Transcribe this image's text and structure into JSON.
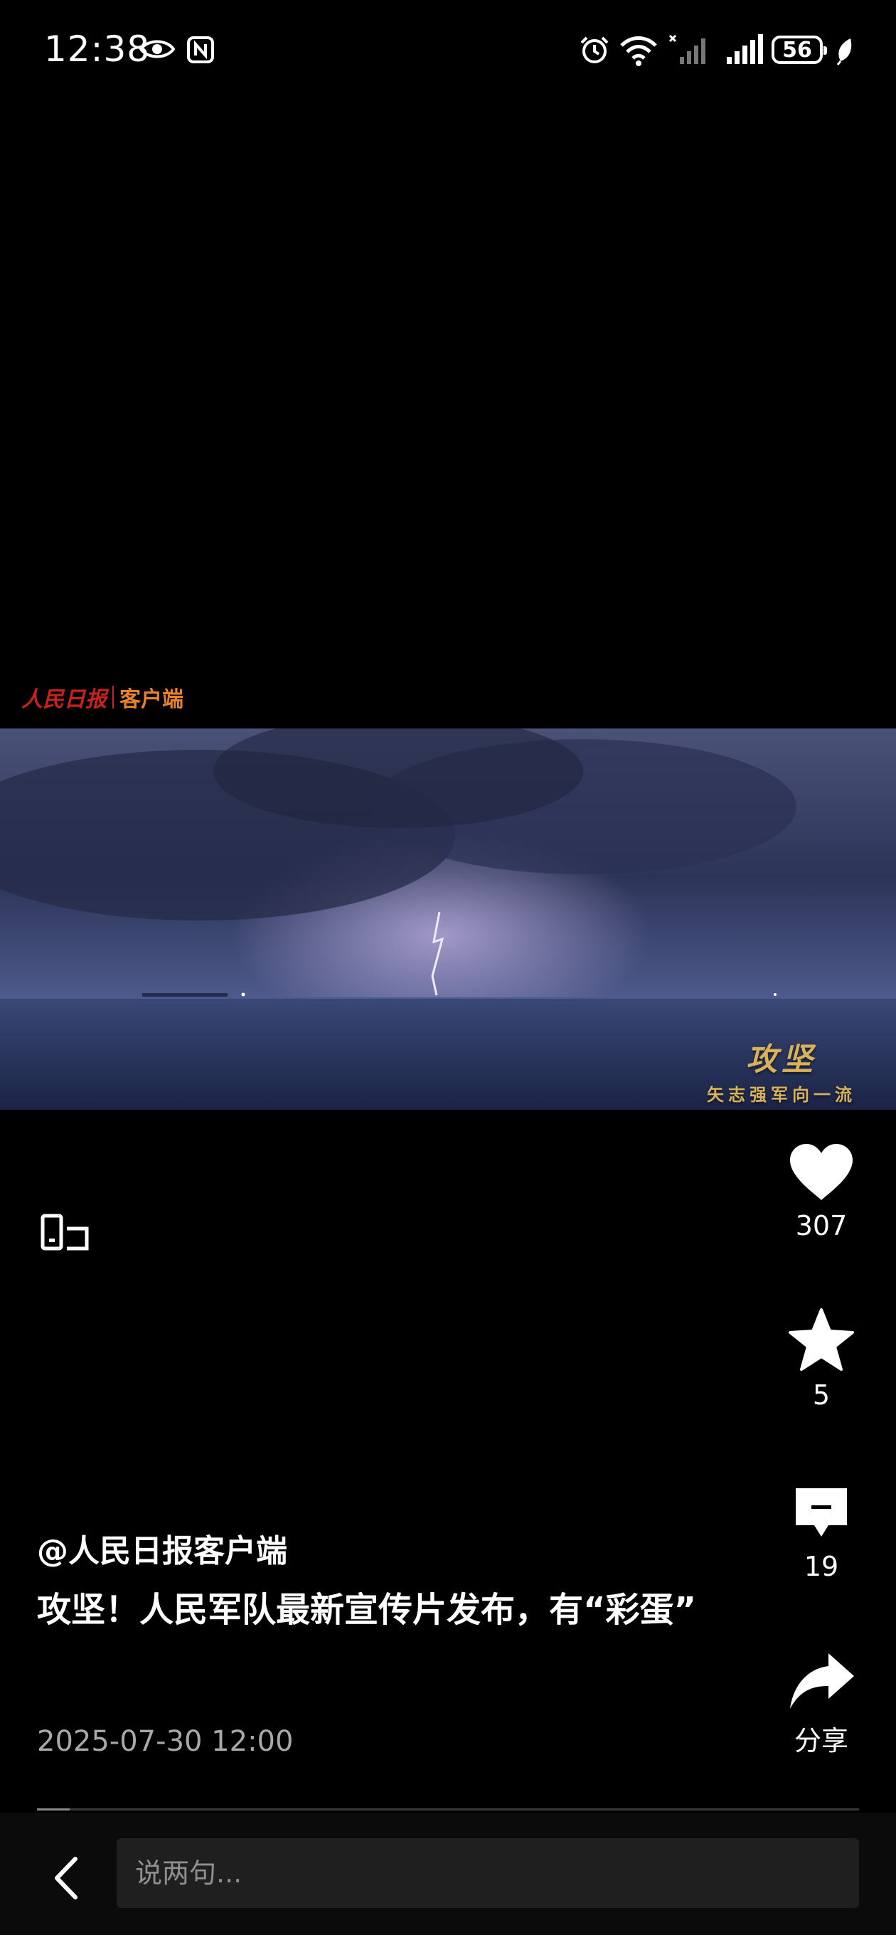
{
  "status_bar": {
    "time": "12:38",
    "battery_level": "56",
    "icons": [
      "eye-icon",
      "nfc-icon",
      "alarm-icon",
      "wifi-icon",
      "signal-no-service-icon",
      "signal-icon",
      "battery-icon",
      "leaf-icon"
    ]
  },
  "watermark": {
    "brand_script": "人民日报",
    "brand_suffix": "客户端"
  },
  "video": {
    "caption_title": "攻坚",
    "caption_subtitle": "矢志强军向一流",
    "playback_progress": 0.04
  },
  "actions": {
    "like_count": "307",
    "favorite_count": "5",
    "comment_count": "19",
    "share_label": "分享"
  },
  "post": {
    "author": "@人民日报客户端",
    "title": "攻坚！人民军队最新宣传片发布，有“彩蛋”",
    "date": "2025-07-30 12:00"
  },
  "comment_box": {
    "placeholder": "说两句..."
  },
  "colors": {
    "background": "#000000",
    "brand_red": "#c8221e",
    "brand_orange": "#e8812a",
    "caption_gold": "#d8b25a"
  }
}
